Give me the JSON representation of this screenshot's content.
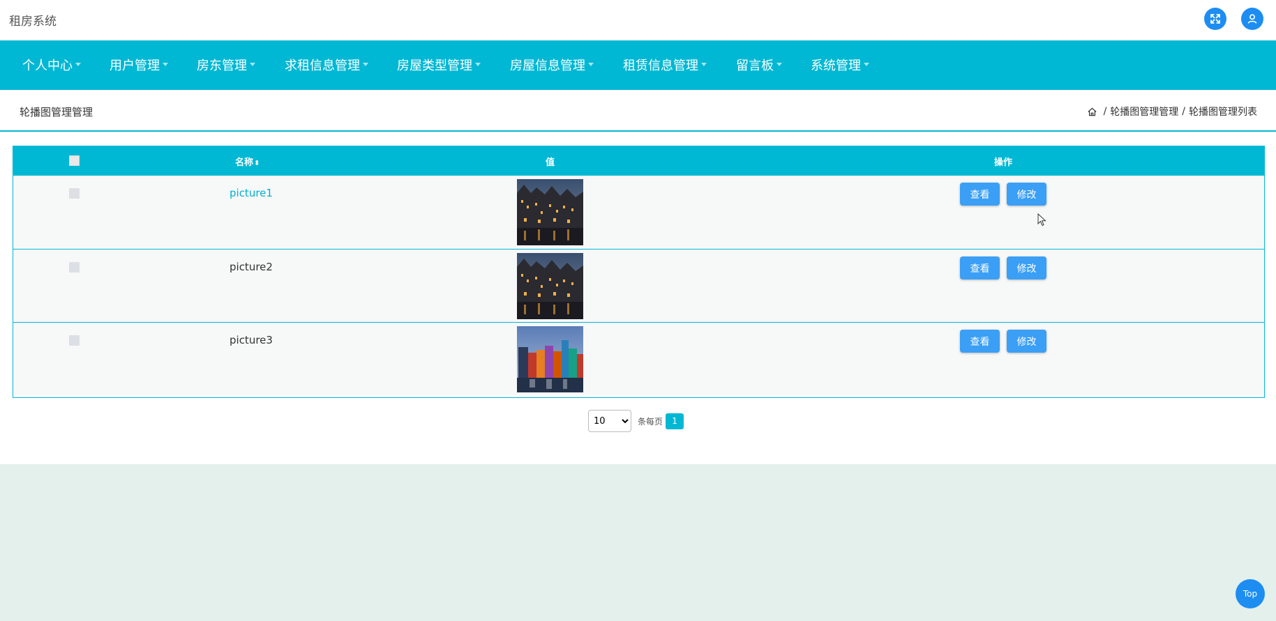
{
  "header": {
    "app_title": "租房系统",
    "icons": [
      "fullscreen-icon",
      "user-icon"
    ]
  },
  "nav": {
    "items": [
      {
        "label": "个人中心"
      },
      {
        "label": "用户管理"
      },
      {
        "label": "房东管理"
      },
      {
        "label": "求租信息管理"
      },
      {
        "label": "房屋类型管理"
      },
      {
        "label": "房屋信息管理"
      },
      {
        "label": "租赁信息管理"
      },
      {
        "label": "留言板"
      },
      {
        "label": "系统管理"
      }
    ]
  },
  "page": {
    "title": "轮播图管理管理",
    "breadcrumb": [
      "轮播图管理管理",
      "轮播图管理列表"
    ],
    "breadcrumb_sep": "/"
  },
  "table": {
    "columns": {
      "name": "名称",
      "value": "值",
      "actions": "操作"
    },
    "rows": [
      {
        "name": "picture1",
        "image": "night-houses-canal"
      },
      {
        "name": "picture2",
        "image": "night-houses-canal"
      },
      {
        "name": "picture3",
        "image": "colorful-houses-waterfront"
      }
    ],
    "view_label": "查看",
    "edit_label": "修改"
  },
  "pagination": {
    "page_size": "10",
    "page_size_options": [
      "10"
    ],
    "per_page_label": "条每页",
    "current_page": "1"
  },
  "top_button": {
    "label": "Top"
  },
  "colors": {
    "primary": "#00b8d4",
    "button": "#3a9ff5",
    "icon_circle": "#1d8df2",
    "background": "#e3f0ec"
  }
}
